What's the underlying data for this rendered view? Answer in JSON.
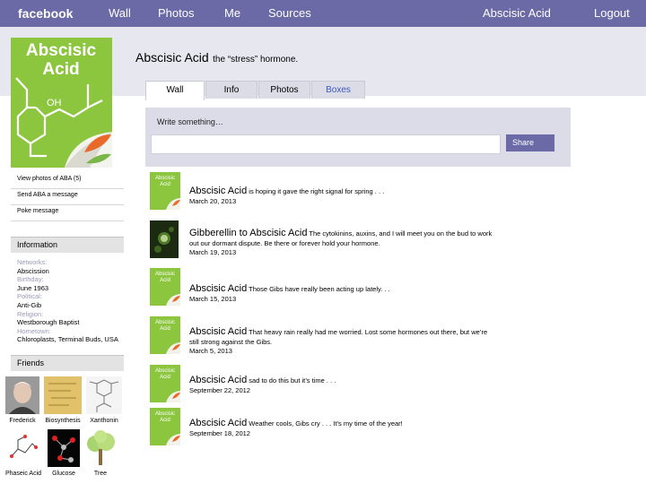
{
  "topbar": {
    "brand": "facebook",
    "nav": [
      "Wall",
      "Photos",
      "Me",
      "Sources"
    ],
    "profile_link": "Abscisic Acid",
    "logout": "Logout"
  },
  "profile": {
    "picture_text": [
      "Abscisic",
      "Acid"
    ],
    "picture_oh": "OH",
    "name": "Abscisic Acid",
    "subtitle": "the “stress” hormone."
  },
  "tabs": [
    {
      "label": "Wall"
    },
    {
      "label": "Info"
    },
    {
      "label": "Photos"
    },
    {
      "label": "Boxes"
    }
  ],
  "side_links": [
    "View photos of ABA (5)",
    "Send ABA a message",
    "Poke message"
  ],
  "information": {
    "heading": "Information",
    "fields": [
      {
        "label": "Networks:",
        "value": "Abscission"
      },
      {
        "label": "Birthday:",
        "value": "June 1963"
      },
      {
        "label": "Political:",
        "value": "Anti-Gib"
      },
      {
        "label": "Religion:",
        "value": "Westborough Baptist"
      },
      {
        "label": "Hometown:",
        "value": "Chloroplasts, Terminal Buds, USA"
      }
    ]
  },
  "friends": {
    "heading": "Friends",
    "list": [
      "Frederick",
      "Biosynthesis",
      "Xanthonin",
      "Phaseic Acid",
      "Glucose",
      "Tree"
    ]
  },
  "composer": {
    "placeholder": "Write something…",
    "share": "Share"
  },
  "posts": [
    {
      "author": "Abscisic Acid",
      "text": "is hoping it gave the right signal for spring . . .",
      "date": "March 20, 2013",
      "avatar": "aba"
    },
    {
      "author": "Gibberellin to Abscisic Acid",
      "text": "The cytokinins, auxins, and I will meet you on the bud to work out our dormant dispute.  Be there or forever hold your hormone.",
      "date": "March 19, 2013",
      "avatar": "gib"
    },
    {
      "author": "Abscisic Acid",
      "text": "Those Gibs have really been acting up lately. . .",
      "date": "March 15, 2013",
      "avatar": "aba"
    },
    {
      "author": "Abscisic Acid",
      "text": "That heavy rain really had me worried.  Lost some hormones out there, but we’re still strong against the Gibs.",
      "date": "March 5, 2013",
      "avatar": "aba"
    },
    {
      "author": "Abscisic Acid",
      "text": "sad to do this but it’s time . . .",
      "date": "September 22, 2012",
      "avatar": "aba"
    },
    {
      "author": "Abscisic Acid",
      "text": "Weather cools, Gibs cry . . . It’s my time of the year!",
      "date": "September 18, 2012",
      "avatar": "aba"
    }
  ],
  "colors": {
    "topbar": "#6b6aa6",
    "band": "#e7e7ef",
    "aba_green": "#8cc63f",
    "link_blue": "#3b59c4"
  }
}
